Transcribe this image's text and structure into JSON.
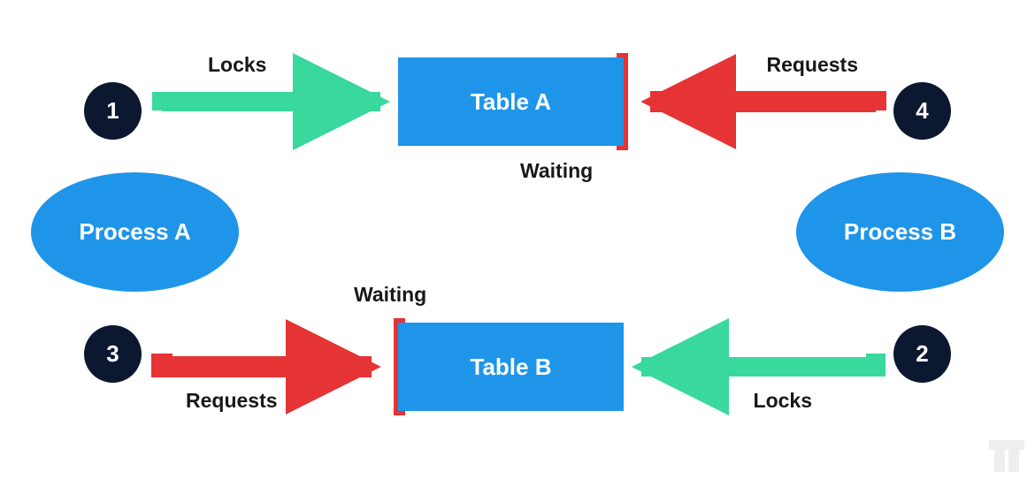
{
  "processes": {
    "a": {
      "label": "Process A"
    },
    "b": {
      "label": "Process B"
    }
  },
  "tables": {
    "a": {
      "label": "Table A"
    },
    "b": {
      "label": "Table B"
    }
  },
  "steps": {
    "s1": "1",
    "s2": "2",
    "s3": "3",
    "s4": "4"
  },
  "labels": {
    "locks": "Locks",
    "requests": "Requests",
    "waiting": "Waiting"
  },
  "colors": {
    "blue": "#1e95e9",
    "green": "#39d89d",
    "red": "#e63333",
    "dark": "#0c1830"
  },
  "diagram_meaning": {
    "type": "deadlock-diagram",
    "description": "Two processes each lock one table and request the other, causing circular wait",
    "edges": [
      {
        "from": "Process A",
        "to": "Table A",
        "action": "Locks",
        "step": 1,
        "color": "green"
      },
      {
        "from": "Process B",
        "to": "Table B",
        "action": "Locks",
        "step": 2,
        "color": "green"
      },
      {
        "from": "Process A",
        "to": "Table B",
        "action": "Requests",
        "step": 3,
        "color": "red",
        "state": "Waiting"
      },
      {
        "from": "Process B",
        "to": "Table A",
        "action": "Requests",
        "step": 4,
        "color": "red",
        "state": "Waiting"
      }
    ]
  }
}
